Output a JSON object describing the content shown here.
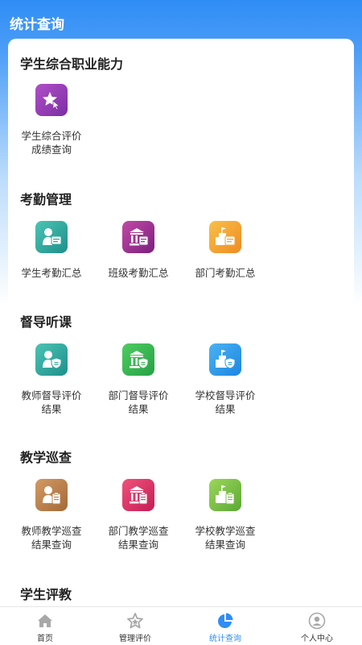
{
  "header": {
    "title": "统计查询"
  },
  "sections": [
    {
      "title": "学生综合职业能力",
      "items": [
        {
          "label": "学生综合评价成绩查询",
          "icon": "star-cursor-icon",
          "color": "#9b3fb8"
        }
      ]
    },
    {
      "title": "考勤管理",
      "items": [
        {
          "label": "学生考勤汇总",
          "icon": "person-doc-icon",
          "color": "#2ea79d"
        },
        {
          "label": "班级考勤汇总",
          "icon": "building-doc-icon",
          "color": "#a1359a"
        },
        {
          "label": "部门考勤汇总",
          "icon": "flag-doc-icon",
          "color": "#f2a233"
        }
      ]
    },
    {
      "title": "督导听课",
      "items": [
        {
          "label": "教师督导评价结果",
          "icon": "person-shield-icon",
          "color": "#2ea79d"
        },
        {
          "label": "部门督导评价结果",
          "icon": "building-shield-icon",
          "color": "#37b552"
        },
        {
          "label": "学校督导评价结果",
          "icon": "flag-shield-icon",
          "color": "#2b9de8"
        }
      ]
    },
    {
      "title": "教学巡查",
      "items": [
        {
          "label": "教师教学巡查结果查询",
          "icon": "person-clipboard-icon",
          "color": "#bb814d"
        },
        {
          "label": "部门教学巡查结果查询",
          "icon": "building-clipboard-icon",
          "color": "#de3a6a"
        },
        {
          "label": "学校教学巡查结果查询",
          "icon": "flag-clipboard-icon",
          "color": "#7cc046"
        }
      ]
    },
    {
      "title": "学生评教",
      "items": []
    }
  ],
  "tabbar": [
    {
      "label": "首页",
      "icon": "home-icon"
    },
    {
      "label": "管理评价",
      "icon": "star-icon"
    },
    {
      "label": "统计查询",
      "icon": "pie-chart-icon",
      "active": true
    },
    {
      "label": "个人中心",
      "icon": "user-icon"
    }
  ],
  "colors": {
    "primary": "#2f8df5",
    "text": "#333333"
  }
}
